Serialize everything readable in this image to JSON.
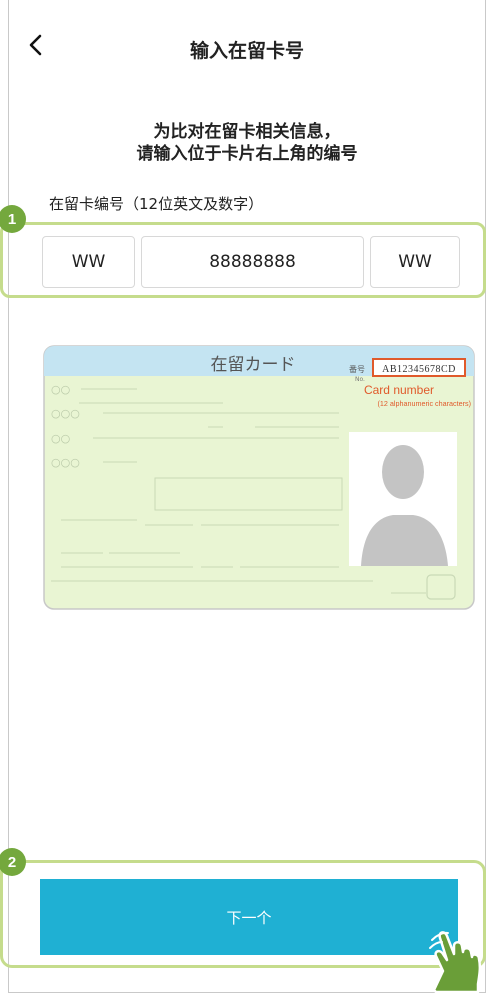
{
  "header": {
    "title": "输入在留卡号",
    "back_icon": "chevron-left-icon"
  },
  "intro": {
    "line1": "为比对在留卡相关信息，",
    "line2": "请输入位于卡片右上角的编号"
  },
  "card_number_field": {
    "label": "在留卡编号（12位英文及数字）",
    "segment1": "WW",
    "segment2": "88888888",
    "segment3": "WW"
  },
  "card_illustration": {
    "title": "在留カード",
    "number_label": "番号",
    "number_sublabel": "No.",
    "number_value": "AB12345678CD",
    "callout_title": "Card number",
    "callout_note": "(12 alphanumeric characters)",
    "row1": "○○",
    "row2": "○○○",
    "row3": "○○",
    "row4": "○○○"
  },
  "markers": {
    "step1": "1",
    "step2": "2"
  },
  "next_button": {
    "label": "下一个"
  },
  "colors": {
    "accent": "#1fb0d3",
    "highlight": "#c5dc8c",
    "marker": "#74a83d",
    "card_bg": "#e9f5d3",
    "card_header": "#c4e4f2",
    "callout": "#e05a2b"
  }
}
